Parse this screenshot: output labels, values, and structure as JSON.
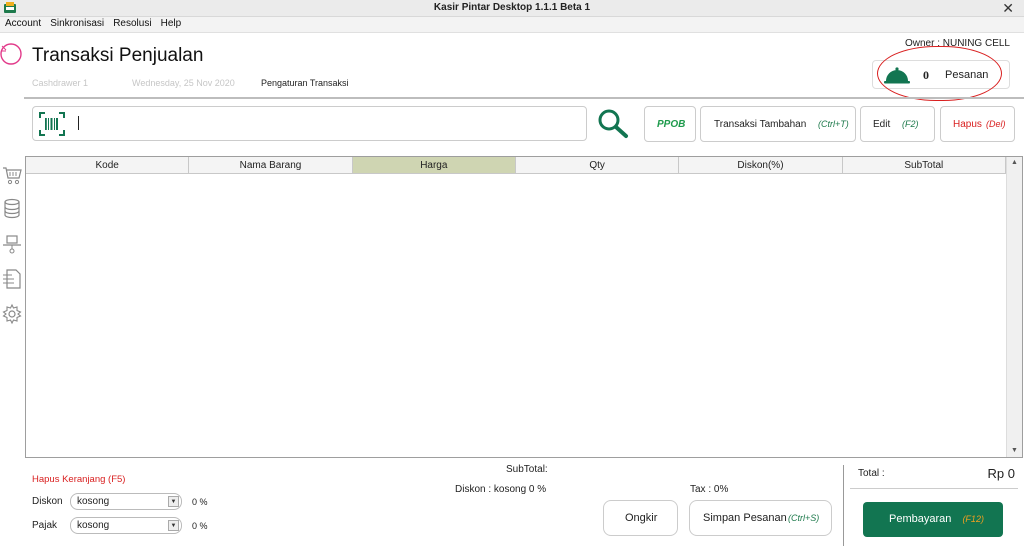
{
  "window": {
    "title": "Kasir Pintar Desktop 1.1.1  Beta 1",
    "close_glyph": "✕"
  },
  "menu": [
    "Account",
    "Sinkronisasi",
    "Resolusi",
    "Help"
  ],
  "sidebar": [
    "cart-icon",
    "database-icon",
    "laptop-icon",
    "report-icon",
    "gear-icon"
  ],
  "header": {
    "title": "Transaksi Penjualan",
    "cashdrawer": "Cashdrawer 1",
    "date": "Wednesday, 25 Nov 2020",
    "settings_link": "Pengaturan Transaksi",
    "owner": "Owner : NUNING CELL",
    "pesanan_count": "0",
    "pesanan_label": "Pesanan"
  },
  "toolbar": {
    "search_value": "",
    "ppob_label": "PPOB",
    "transaksi_tambahan": "Transaksi Tambahan",
    "transaksi_tambahan_key": "(Ctrl+T)",
    "edit": "Edit",
    "edit_key": "(F2)",
    "hapus": "Hapus",
    "hapus_key": "(Del)"
  },
  "table": {
    "columns": [
      "Kode",
      "Nama Barang",
      "Harga",
      "Qty",
      "Diskon(%)",
      "SubTotal"
    ],
    "selected_column": "Harga",
    "rows": []
  },
  "footer": {
    "hapus_keranjang": "Hapus Keranjang (F5)",
    "diskon_label": "Diskon",
    "diskon_value": "kosong",
    "diskon_pct": "0 %",
    "pajak_label": "Pajak",
    "pajak_value": "kosong",
    "pajak_pct": "0 %",
    "subtotal_label": "SubTotal:",
    "diskon_summary": "Diskon : kosong 0 %",
    "tax_summary": "Tax : 0%",
    "ongkir": "Ongkir",
    "simpan_pesanan": "Simpan Pesanan",
    "simpan_key": "(Ctrl+S)",
    "total_label": "Total :",
    "total_value": "Rp 0",
    "pembayaran": "Pembayaran",
    "pembayaran_key": "(F12)"
  },
  "colors": {
    "accent": "#127551",
    "warning": "#d92020",
    "shortcut": "#1e7a4c",
    "selected_header": "#cfd5b2"
  }
}
